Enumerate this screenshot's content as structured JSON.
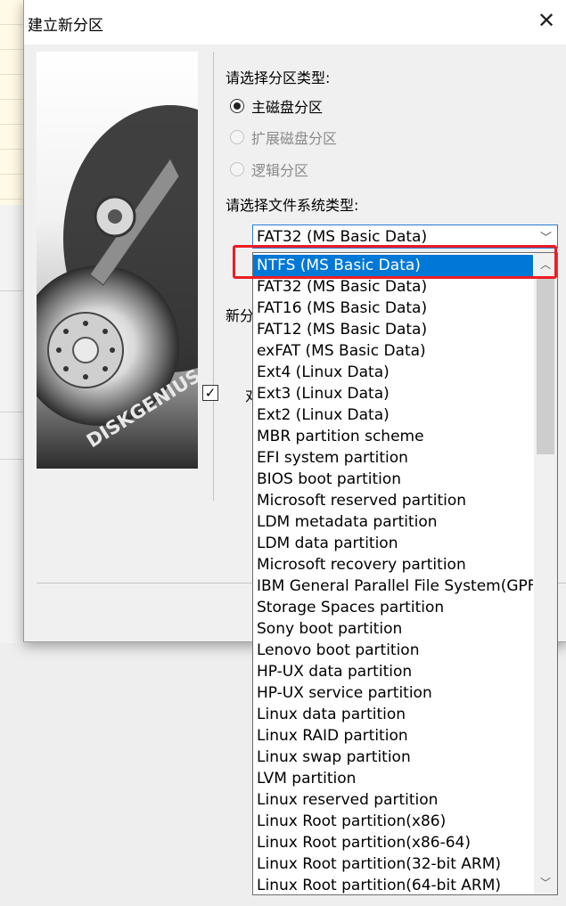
{
  "dialog": {
    "title": "建立新分区",
    "close_icon": "close-icon"
  },
  "banner": {
    "brand": "DISKGENIUS"
  },
  "partition_type": {
    "label": "请选择分区类型:",
    "options": [
      {
        "label": "主磁盘分区",
        "checked": true,
        "enabled": true
      },
      {
        "label": "扩展磁盘分区",
        "checked": false,
        "enabled": false
      },
      {
        "label": "逻辑分区",
        "checked": false,
        "enabled": false
      }
    ]
  },
  "filesystem": {
    "label": "请选择文件系统类型:",
    "selected_value": "FAT32 (MS Basic Data)",
    "highlighted_index": 0,
    "items": [
      "NTFS (MS Basic Data)",
      "FAT32 (MS Basic Data)",
      "FAT16 (MS Basic Data)",
      "FAT12 (MS Basic Data)",
      "exFAT (MS Basic Data)",
      "Ext4 (Linux Data)",
      "Ext3 (Linux Data)",
      "Ext2 (Linux Data)",
      "MBR partition scheme",
      "EFI system partition",
      "BIOS boot partition",
      "Microsoft reserved partition",
      "LDM metadata partition",
      "LDM data partition",
      "Microsoft recovery partition",
      "IBM General Parallel File System(GPF",
      "Storage Spaces partition",
      "Sony boot partition",
      "Lenovo boot partition",
      "HP-UX data partition",
      "HP-UX service partition",
      "Linux data partition",
      "Linux RAID partition",
      "Linux swap partition",
      "LVM partition",
      "Linux reserved partition",
      "Linux Root partition(x86)",
      "Linux Root partition(x86-64)",
      "Linux Root partition(32-bit ARM)",
      "Linux Root partition(64-bit ARM)"
    ]
  },
  "partial_labels": {
    "size_label_fragment": "新分",
    "checkbox_fragment": "对"
  },
  "colors": {
    "selection": "#0078d7",
    "annotation_red": "#ec1c24"
  }
}
